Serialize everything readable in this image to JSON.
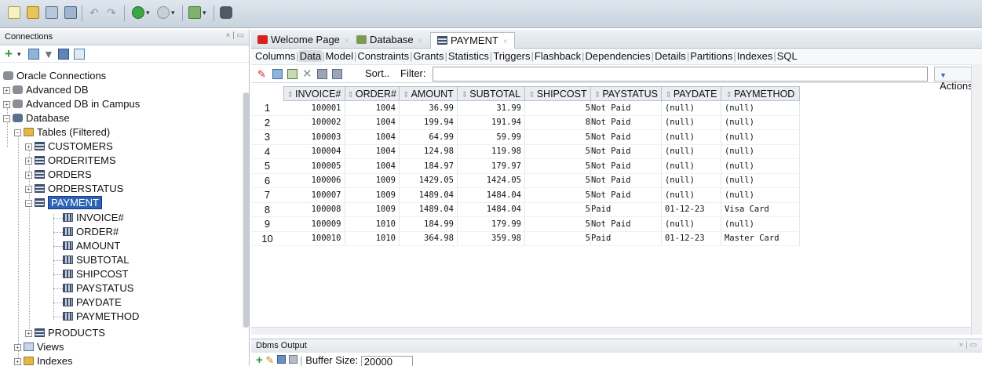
{
  "colors": {
    "selection": "#2f63b6",
    "toolbar": "#c9d3de",
    "grid_header": "#e9ecf0"
  },
  "left_panel": {
    "title": "Connections",
    "tree": {
      "oracle_connections": "Oracle Connections",
      "advanced_db": "Advanced DB",
      "advanced_db_campus": "Advanced DB in Campus",
      "database": "Database",
      "tables_filtered": "Tables (Filtered)",
      "tables": [
        "CUSTOMERS",
        "ORDERITEMS",
        "ORDERS",
        "ORDERSTATUS"
      ],
      "selected_table": "PAYMENT",
      "columns": [
        "INVOICE#",
        "ORDER#",
        "AMOUNT",
        "SUBTOTAL",
        "SHIPCOST",
        "PAYSTATUS",
        "PAYDATE",
        "PAYMETHOD"
      ],
      "products": "PRODUCTS",
      "views": "Views",
      "indexes": "Indexes"
    }
  },
  "tabs": [
    {
      "label": "Welcome Page",
      "icon": "oracle-icon"
    },
    {
      "label": "Database",
      "icon": "database-icon"
    },
    {
      "label": "PAYMENT",
      "icon": "table-icon"
    }
  ],
  "subtabs": [
    "Columns",
    "Data",
    "Model",
    "Constraints",
    "Grants",
    "Statistics",
    "Triggers",
    "Flashback",
    "Dependencies",
    "Details",
    "Partitions",
    "Indexes",
    "SQL"
  ],
  "grid_toolbar": {
    "sort_label": "Sort..",
    "filter_label": "Filter:",
    "filter_value": "",
    "actions_label": "Actions..."
  },
  "grid": {
    "headers": [
      "INVOICE#",
      "ORDER#",
      "AMOUNT",
      "SUBTOTAL",
      "SHIPCOST",
      "PAYSTATUS",
      "PAYDATE",
      "PAYMETHOD"
    ],
    "rows": [
      [
        "1",
        "100001",
        "1004",
        "36.99",
        "31.99",
        "5",
        "Not Paid",
        "(null)",
        "(null)"
      ],
      [
        "2",
        "100002",
        "1004",
        "199.94",
        "191.94",
        "8",
        "Not Paid",
        "(null)",
        "(null)"
      ],
      [
        "3",
        "100003",
        "1004",
        "64.99",
        "59.99",
        "5",
        "Not Paid",
        "(null)",
        "(null)"
      ],
      [
        "4",
        "100004",
        "1004",
        "124.98",
        "119.98",
        "5",
        "Not Paid",
        "(null)",
        "(null)"
      ],
      [
        "5",
        "100005",
        "1004",
        "184.97",
        "179.97",
        "5",
        "Not Paid",
        "(null)",
        "(null)"
      ],
      [
        "6",
        "100006",
        "1009",
        "1429.05",
        "1424.05",
        "5",
        "Not Paid",
        "(null)",
        "(null)"
      ],
      [
        "7",
        "100007",
        "1009",
        "1489.04",
        "1484.04",
        "5",
        "Not Paid",
        "(null)",
        "(null)"
      ],
      [
        "8",
        "100008",
        "1009",
        "1489.04",
        "1484.04",
        "5",
        "Paid",
        "01-12-23",
        "Visa Card"
      ],
      [
        "9",
        "100009",
        "1010",
        "184.99",
        "179.99",
        "5",
        "Not Paid",
        "(null)",
        "(null)"
      ],
      [
        "10",
        "100010",
        "1010",
        "364.98",
        "359.98",
        "5",
        "Paid",
        "01-12-23",
        "Master Card"
      ]
    ]
  },
  "dbms_output": {
    "title": "Dbms Output",
    "buffer_label": "Buffer Size:",
    "buffer_value": "20000"
  }
}
